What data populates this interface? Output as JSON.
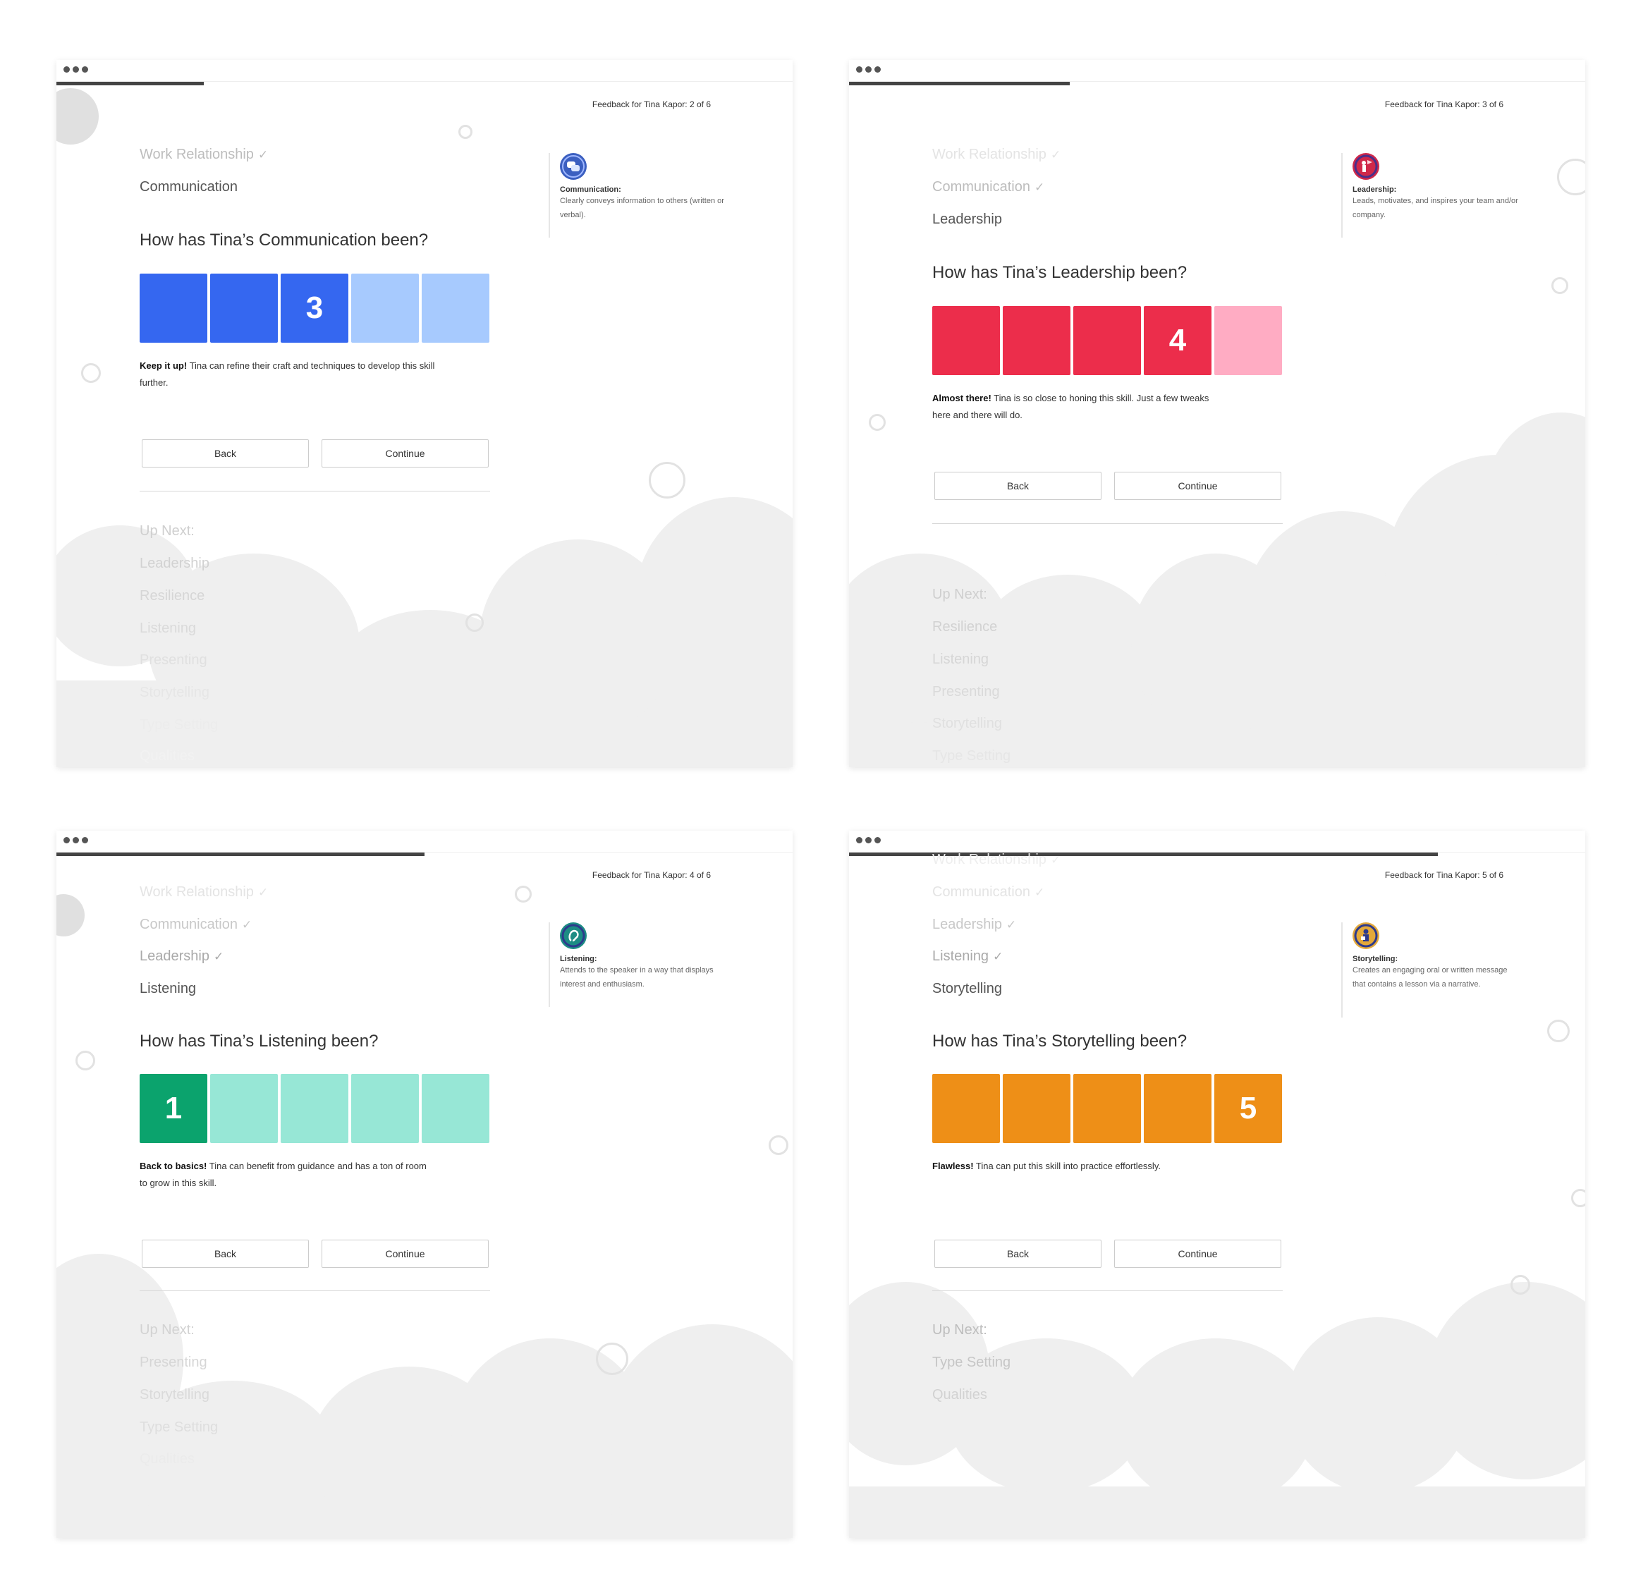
{
  "windows": [
    {
      "counter": "Feedback for Tina Kapor: 2 of 6",
      "progress": 0.2,
      "completed_steps": [
        "Work Relationship"
      ],
      "current_step": "Communication",
      "question": "How has Tina’s Communication been?",
      "rating": "3",
      "message_bold": "Keep it up!",
      "message": "Tina can refine their craft and techniques to develop this skill further.",
      "back_label": "Back",
      "continue_label": "Continue",
      "up_next_label": "Up Next:",
      "up_next": [
        "Leadership",
        "Resilience",
        "Listening",
        "Presenting",
        "Storytelling",
        "Type Setting",
        "Qualities"
      ],
      "sidebar_title": "Communication:",
      "sidebar_desc": "Clearly conveys information to others (written or verbal).",
      "icon": "chat-bubbles-icon",
      "colors": {
        "filled": "#3567f0",
        "empty": "#a7cafe",
        "icon": "#3b5fc0"
      }
    },
    {
      "counter": "Feedback for Tina Kapor: 3 of 6",
      "progress": 0.3,
      "completed_steps": [
        "Work Relationship",
        "Communication"
      ],
      "current_step": "Leadership",
      "question": "How has Tina’s Leadership been?",
      "rating": "4",
      "message_bold": "Almost there!",
      "message": "Tina is so close to honing this skill. Just a few tweaks here and there will do.",
      "back_label": "Back",
      "continue_label": "Continue",
      "up_next_label": "Up Next:",
      "up_next": [
        "Resilience",
        "Listening",
        "Presenting",
        "Storytelling",
        "Type Setting"
      ],
      "sidebar_title": "Leadership:",
      "sidebar_desc": "Leads, motivates, and inspires your team and/or company.",
      "icon": "leader-flag-icon",
      "colors": {
        "filled": "#ec2d4b",
        "empty": "#ffacc3",
        "icon": "#d0284a"
      }
    },
    {
      "counter": "Feedback for Tina Kapor: 4 of 6",
      "progress": 0.5,
      "completed_steps": [
        "Work Relationship",
        "Communication",
        "Leadership"
      ],
      "current_step": "Listening",
      "question": "How has Tina’s Listening been?",
      "rating": "1",
      "message_bold": "Back to basics!",
      "message": "Tina can benefit from guidance and has a ton of room to grow in this skill.",
      "back_label": "Back",
      "continue_label": "Continue",
      "up_next_label": "Up Next:",
      "up_next": [
        "Presenting",
        "Storytelling",
        "Type Setting",
        "Qualities"
      ],
      "sidebar_title": "Listening:",
      "sidebar_desc": "Attends to the speaker in a way that displays interest and enthusiasm.",
      "icon": "ear-icon",
      "colors": {
        "filled": "#0ba36d",
        "empty": "#97e7d6",
        "icon": "#1d8c84"
      }
    },
    {
      "counter": "Feedback for Tina Kapor: 5 of 6",
      "progress": 0.8,
      "completed_steps": [
        "Work Relationship",
        "Communication",
        "Leadership",
        "Listening"
      ],
      "current_step": "Storytelling",
      "question": "How has Tina’s Storytelling been?",
      "rating": "5",
      "message_bold": "Flawless!",
      "message": "Tina can put this skill into practice effortlessly.",
      "back_label": "Back",
      "continue_label": "Continue",
      "up_next_label": "Up Next:",
      "up_next": [
        "Type Setting",
        "Qualities"
      ],
      "sidebar_title": "Storytelling:",
      "sidebar_desc": "Creates an engaging oral or written message that contains a lesson via a narrative.",
      "icon": "storyteller-icon",
      "colors": {
        "filled": "#ee8f17",
        "empty": "#ee8f17",
        "icon": "#e4a93a"
      }
    }
  ]
}
